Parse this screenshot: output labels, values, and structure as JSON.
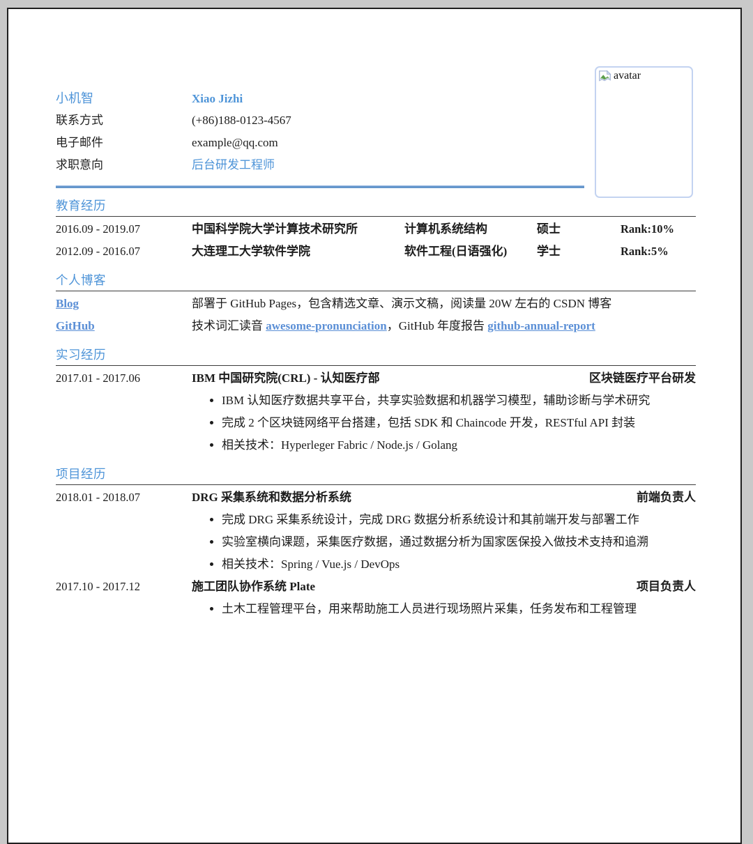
{
  "colors": {
    "accent": "#4e94d8",
    "link": "#5b8fd6",
    "divider": "#6596cc",
    "avatar_border": "#c3d3f1"
  },
  "avatar": {
    "alt": "avatar"
  },
  "header": {
    "name_cn": "小机智",
    "name_en": "Xiao Jizhi",
    "contact_label": "联系方式",
    "contact_value": "(+86)188-0123-4567",
    "email_label": "电子邮件",
    "email_value": "example@qq.com",
    "intent_label": "求职意向",
    "intent_value": "后台研发工程师"
  },
  "education": {
    "title": "教育经历",
    "rows": [
      {
        "date": "2016.09 - 2019.07",
        "school": "中国科学院大学计算技术研究所",
        "major": "计算机系统结构",
        "degree": "硕士",
        "rank": "Rank:10%"
      },
      {
        "date": "2012.09 - 2016.07",
        "school": "大连理工大学软件学院",
        "major": "软件工程(日语强化)",
        "degree": "学士",
        "rank": "Rank:5%"
      }
    ]
  },
  "blog": {
    "title": "个人博客",
    "rows": [
      {
        "link": "Blog",
        "text": "部署于 GitHub Pages，包含精选文章、演示文稿，阅读量 20W 左右的 CSDN 博客"
      },
      {
        "link": "GitHub",
        "text_a": "技术词汇读音 ",
        "link_a": "awesome-pronunciation",
        "text_b": "，GitHub 年度报告 ",
        "link_b": "github-annual-report"
      }
    ]
  },
  "internship": {
    "title": "实习经历",
    "items": [
      {
        "date": "2017.01 - 2017.06",
        "name": "IBM 中国研究院(CRL) - 认知医疗部",
        "role": "区块链医疗平台研发",
        "bullets": [
          "IBM 认知医疗数据共享平台，共享实验数据和机器学习模型，辅助诊断与学术研究",
          "完成 2 个区块链网络平台搭建，包括 SDK 和 Chaincode 开发，RESTful API 封装",
          "相关技术：Hyperleger Fabric / Node.js / Golang"
        ]
      }
    ]
  },
  "projects": {
    "title": "项目经历",
    "items": [
      {
        "date": "2018.01 - 2018.07",
        "name": "DRG 采集系统和数据分析系统",
        "role": "前端负责人",
        "bullets": [
          "完成 DRG 采集系统设计，完成 DRG 数据分析系统设计和其前端开发与部署工作",
          "实验室横向课题，采集医疗数据，通过数据分析为国家医保投入做技术支持和追溯",
          "相关技术：Spring / Vue.js / DevOps"
        ]
      },
      {
        "date": "2017.10 - 2017.12",
        "name": "施工团队协作系统 Plate",
        "role": "项目负责人",
        "bullets": [
          "土木工程管理平台，用来帮助施工人员进行现场照片采集，任务发布和工程管理"
        ]
      }
    ]
  }
}
